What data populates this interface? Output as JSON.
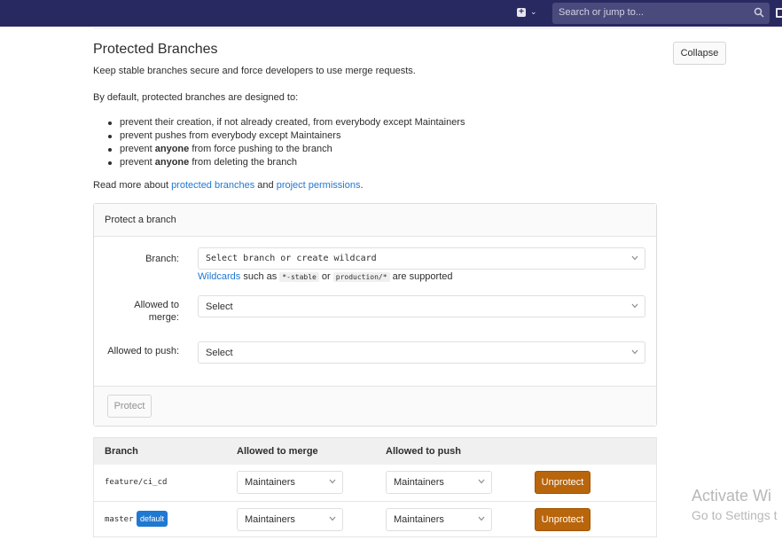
{
  "topbar": {
    "search_placeholder": "Search or jump to...",
    "colors": {
      "bg": "#292961",
      "search_bg": "#4a4a7c"
    }
  },
  "section": {
    "title": "Protected Branches",
    "collapse_label": "Collapse",
    "description": "Keep stable branches secure and force developers to use merge requests.",
    "by_default": "By default, protected branches are designed to:",
    "bullets": [
      {
        "before": "prevent their creation, if not already created, from everybody except Maintainers",
        "strong": "",
        "after": ""
      },
      {
        "before": "prevent pushes from everybody except Maintainers",
        "strong": "",
        "after": ""
      },
      {
        "before": "prevent ",
        "strong": "anyone",
        "after": " from force pushing to the branch"
      },
      {
        "before": "prevent ",
        "strong": "anyone",
        "after": " from deleting the branch"
      }
    ],
    "read_more": {
      "prefix": "Read more about ",
      "link1": "protected branches",
      "middle": " and ",
      "link2": "project permissions",
      "suffix": "."
    }
  },
  "protect_form": {
    "header": "Protect a branch",
    "branch_label": "Branch:",
    "branch_value": "Select branch or create wildcard",
    "hint": {
      "link": "Wildcards",
      "text1": " such as ",
      "code1": "*-stable",
      "text2": " or ",
      "code2": "production/*",
      "text3": " are supported"
    },
    "merge_label_1": "Allowed to",
    "merge_label_2": "merge:",
    "merge_value": "Select",
    "push_label": "Allowed to push:",
    "push_value": "Select",
    "protect_button": "Protect"
  },
  "table": {
    "headers": [
      "Branch",
      "Allowed to merge",
      "Allowed to push"
    ],
    "rows": [
      {
        "branch": "feature/ci_cd",
        "badge": "",
        "merge": "Maintainers",
        "push": "Maintainers",
        "action": "Unprotect"
      },
      {
        "branch": "master",
        "badge": "default",
        "merge": "Maintainers",
        "push": "Maintainers",
        "action": "Unprotect"
      }
    ],
    "colors": {
      "unprotect": "#b9650c",
      "badge": "#1f78d1"
    }
  },
  "watermark": {
    "line1": "Activate Wi",
    "line2": "Go to Settings t"
  }
}
